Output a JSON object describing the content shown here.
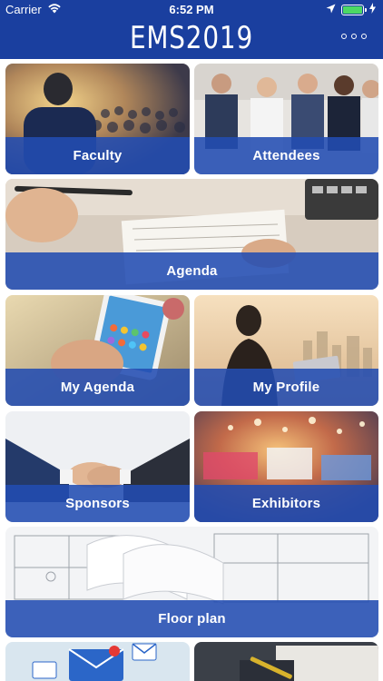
{
  "status_bar": {
    "carrier": "Carrier",
    "time": "6:52 PM",
    "battery_level": 1.0
  },
  "app": {
    "title": "EMS2019"
  },
  "colors": {
    "header": "#1a3f9f",
    "tile_label_bar": "#224cb2",
    "battery_fill": "#4cd964"
  },
  "tiles": {
    "faculty": "Faculty",
    "attendees": "Attendees",
    "agenda": "Agenda",
    "my_agenda": "My Agenda",
    "my_profile": "My Profile",
    "sponsors": "Sponsors",
    "exhibitors": "Exhibitors",
    "floor_plan": "Floor plan"
  },
  "icons": {
    "wifi": "wifi-icon",
    "location": "location-arrow-icon",
    "battery": "battery-icon",
    "charging": "bolt-icon",
    "more": "more-dots-icon"
  }
}
